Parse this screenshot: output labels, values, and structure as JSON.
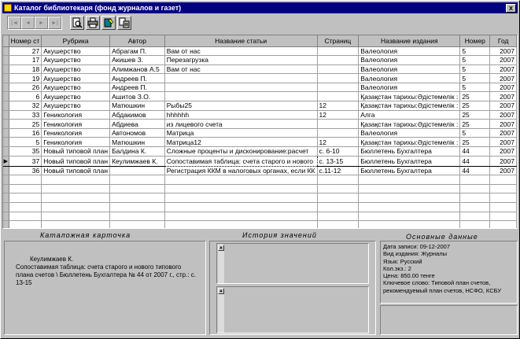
{
  "window": {
    "title": "Каталог библиотекаря (фонд журналов и газет)",
    "close_label": "x"
  },
  "toolbar": {
    "nav": [
      "|◄",
      "◄",
      "►",
      "►|"
    ],
    "tools": [
      "preview-icon",
      "print-icon",
      "edit-icon",
      "export-icon"
    ]
  },
  "grid": {
    "columns": [
      "Номер ст",
      "Рубрика",
      "Автор",
      "Название статьи",
      "Страниц",
      "Название издания",
      "Номер",
      "Год"
    ],
    "rows": [
      [
        "27",
        "Акушерство",
        "Абрагам П.",
        "Вам от нас",
        "",
        "Валеология",
        "5",
        "2007"
      ],
      [
        "17",
        "Акушерство",
        "Акишев З.",
        "Перезагрузка",
        "",
        "Валеология",
        "5",
        "2007"
      ],
      [
        "18",
        "Акушерство",
        "Алимжанов А.5",
        "Вам от нас",
        "",
        "Валеология",
        "5",
        "2007"
      ],
      [
        "19",
        "Акушерство",
        "Андреев П.",
        "",
        "",
        "Валеология",
        "5",
        "2007"
      ],
      [
        "26",
        "Акушерство",
        "Андреев П.",
        "",
        "",
        "Валеология",
        "5",
        "2007"
      ],
      [
        "6",
        "Акушерство",
        "Ашитов З.О.",
        "",
        "",
        "Қазақстан тарихы:Әдістемелік :",
        "25",
        "2007"
      ],
      [
        "32",
        "Акушерство",
        "Матюшкин",
        "Рыбы25",
        "12",
        "Қазақстан тарихы:Әдістемелік :",
        "25",
        "2007"
      ],
      [
        "33",
        "Гениколоғия",
        "Абдакимов",
        "hhhhhh",
        "12",
        "Алга",
        "25",
        "2007"
      ],
      [
        "25",
        "Гениколоғия",
        "Абдиева",
        "из лицевого счета",
        "",
        "Қазақстан тарихы:Әдістемелік :",
        "25",
        "2007"
      ],
      [
        "16",
        "Гениколоғия",
        "Автономов",
        "Матрица",
        "",
        "Валеология",
        "5",
        "2007"
      ],
      [
        "5",
        "Гениколоғия",
        "Матюшкин",
        "Матрица12",
        "12",
        "Қазақстан тарихы:Әдістемелік :",
        "25",
        "2007"
      ],
      [
        "35",
        "Новый типовой план",
        "Балдина К.",
        "Сложные проценты и дисконирование:расчет",
        "с. 6-10",
        "Бюллетень Бухгалтера",
        "44",
        "2007"
      ],
      [
        "37",
        "Новый типовой план",
        "Кеулимжаев К.",
        "Сопоставимая таблица: счета старого и нового",
        "с. 13-15",
        "Бюллетень Бухгалтера",
        "44",
        "2007"
      ],
      [
        "36",
        "Новый типовой план",
        "",
        "Регистрация ККМ в налоговых органах, если КК",
        "с.11-12",
        "Бюллетень Бухгалтера",
        "44",
        "2007"
      ]
    ],
    "selected_row": 12
  },
  "panels": {
    "card_title": "Каталожная карточка",
    "history_title": "История значений",
    "details_title": "Основные данные"
  },
  "card": {
    "author": "Кеулимжаев К.",
    "text": "Сопоставимая таблица: счета старого и нового типового плана счетов \\ Бюллетень Бухгалтера № 44 от 2007 г., стр.: с. 13-15"
  },
  "details": {
    "lines": [
      "Дата записи: 09-12-2007",
      "Вид издания: Журналы",
      "Язык: Русский",
      "Кол.экз.: 2",
      "Цена: 850.00 тенге",
      "Ключевое слово: Типовой план счетов,",
      "рекомендуемый план счетов, НСФО, КСБУ"
    ]
  }
}
